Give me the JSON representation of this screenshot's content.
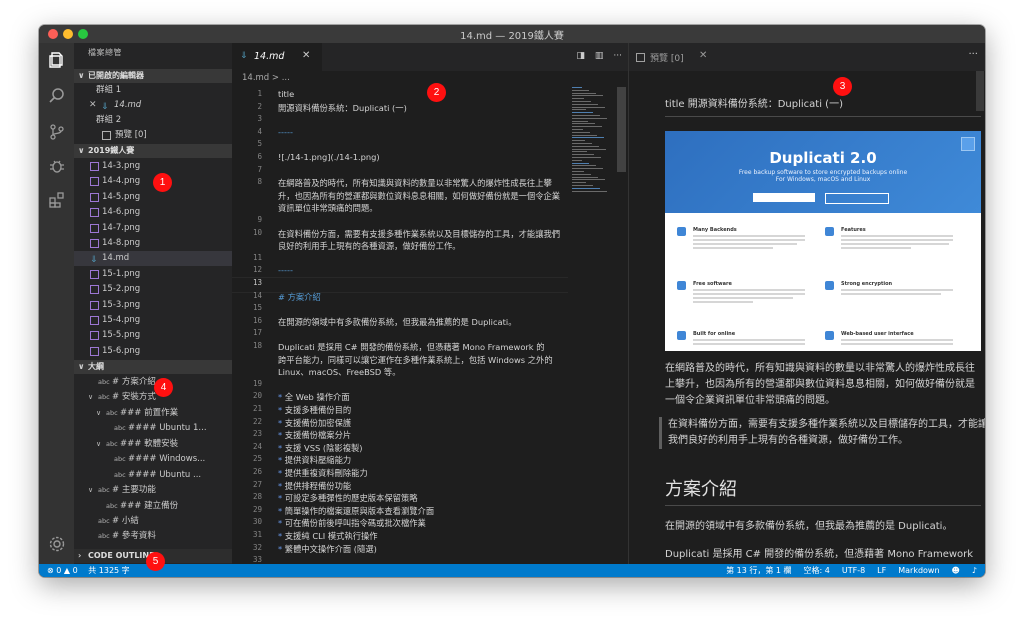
{
  "window": {
    "title": "14.md — 2019鐵人賽"
  },
  "sidebar": {
    "title": "檔案總管",
    "open_editors": {
      "header": "已開啟的編輯器",
      "group1": "群組 1",
      "file1": "14.md",
      "group2": "群組 2",
      "file2": "預覽 [0]"
    },
    "project": {
      "header": "2019鐵人賽",
      "files": [
        "14-3.png",
        "14-4.png",
        "14-5.png",
        "14-6.png",
        "14-7.png",
        "14-8.png",
        "14.md",
        "15-1.png",
        "15-2.png",
        "15-3.png",
        "15-4.png",
        "15-5.png",
        "15-6.png"
      ]
    },
    "outline": {
      "header": "大綱",
      "items": [
        "# 方案介紹",
        "# 安裝方式",
        "### 前置作業",
        "#### Ubuntu 1...",
        "### 軟體安裝",
        "#### Windows...",
        "#### Ubuntu ...",
        "# 主要功能",
        "### 建立備份",
        "# 小結",
        "# 參考資料"
      ],
      "abc": "abc"
    },
    "code_outline": "CODE OUTLINE"
  },
  "editor": {
    "tab_label": "14.md",
    "breadcrumb": "14.md > ...",
    "lines": [
      {
        "n": "1",
        "t": "title"
      },
      {
        "n": "2",
        "t": "開源資料備份系統：Duplicati (一)"
      },
      {
        "n": "3",
        "t": ""
      },
      {
        "n": "4",
        "t": "-----"
      },
      {
        "n": "5",
        "t": ""
      },
      {
        "n": "6",
        "t": "![./14-1.png](./14-1.png)"
      },
      {
        "n": "7",
        "t": ""
      },
      {
        "n": "8",
        "t": "在網路普及的時代，所有知識與資料的數量以非常驚人的爆炸性成長往上攀"
      },
      {
        "n": "",
        "t": "升，也因為所有的營運都與數位資料息息相關，如何做好備份就是一個令企業"
      },
      {
        "n": "",
        "t": "資訊單位非常頭痛的問題。"
      },
      {
        "n": "9",
        "t": ""
      },
      {
        "n": "10",
        "t": "在資料備份方面，需要有支援多種作業系統以及目標儲存的工具，才能讓我們"
      },
      {
        "n": "",
        "t": "良好的利用手上現有的各種資源，做好備份工作。"
      },
      {
        "n": "11",
        "t": ""
      },
      {
        "n": "12",
        "t": "-----"
      },
      {
        "n": "13",
        "t": ""
      },
      {
        "n": "14",
        "t": "# 方案介紹"
      },
      {
        "n": "15",
        "t": ""
      },
      {
        "n": "16",
        "t": "在開源的領域中有多款備份系統，但我最為推薦的是 Duplicati。"
      },
      {
        "n": "17",
        "t": ""
      },
      {
        "n": "18",
        "t": "Duplicati 是採用 C# 開發的備份系統，但憑藉著 Mono Framework 的"
      },
      {
        "n": "",
        "t": "跨平台能力，同樣可以讓它運作在多種作業系統上，包括 Windows 之外的"
      },
      {
        "n": "",
        "t": "Linux、macOS、FreeBSD 等。"
      },
      {
        "n": "19",
        "t": ""
      },
      {
        "n": "20",
        "t": "* 全 Web 操作介面"
      },
      {
        "n": "21",
        "t": "* 支援多種備份目的"
      },
      {
        "n": "22",
        "t": "* 支援備份加密保護"
      },
      {
        "n": "23",
        "t": "* 支援備份檔案分片"
      },
      {
        "n": "24",
        "t": "* 支援 VSS (陰影複製)"
      },
      {
        "n": "25",
        "t": "* 提供資料壓縮能力"
      },
      {
        "n": "26",
        "t": "* 提供重複資料刪除能力"
      },
      {
        "n": "27",
        "t": "* 提供排程備份功能"
      },
      {
        "n": "28",
        "t": "* 可設定多種彈性的歷史版本保留策略"
      },
      {
        "n": "29",
        "t": "* 簡單操作的檔案還原與版本查看瀏覽介面"
      },
      {
        "n": "30",
        "t": "* 可在備份前後呼叫指令碼或批次檔作業"
      },
      {
        "n": "31",
        "t": "* 支援純 CLI 模式執行操作"
      },
      {
        "n": "32",
        "t": "* 繁體中文操作介面 (隨選)"
      },
      {
        "n": "33",
        "t": ""
      }
    ]
  },
  "preview": {
    "tab_label": "預覽 [0]",
    "title": "title 開源資料備份系統：Duplicati (一)",
    "image": {
      "hero_title": "Duplicati 2.0",
      "hero_sub1": "Free backup software to store encrypted backups online",
      "hero_sub2": "For Windows, macOS and Linux",
      "features": [
        "Many Backends",
        "Features",
        "Free software",
        "Strong encryption",
        "Built for online",
        "Web-based user interface"
      ]
    },
    "p1": "在網路普及的時代，所有知識與資料的數量以非常驚人的爆炸性成長往上攀升，也因為所有的營運都與數位資料息息相關，如何做好備份就是一個令企業資訊單位非常頭痛的問題。",
    "quote": "在資料備份方面，需要有支援多種作業系統以及目標儲存的工具，才能讓我們良好的利用手上現有的各種資源，做好備份工作。",
    "h1": "方案介紹",
    "p2": "在開源的領域中有多款備份系統，但我最為推薦的是 Duplicati。",
    "p3": "Duplicati 是採用 C# 開發的備份系統，但憑藉著 Mono Framework 的跨平台能力，同樣可以讓它運作在多種作業系統上，包括 Windows 之外"
  },
  "statusbar": {
    "errors": "0",
    "warnings": "0",
    "word_count": "共 1325 字",
    "position": "第 13 行，第 1 欄",
    "spaces": "空格: 4",
    "encoding": "UTF-8",
    "eol": "LF",
    "language": "Markdown"
  },
  "badges": [
    "1",
    "2",
    "3",
    "4",
    "5"
  ],
  "colors": {
    "accent": "#007acc",
    "badge": "#ff1010",
    "heading": "#569cd6"
  }
}
